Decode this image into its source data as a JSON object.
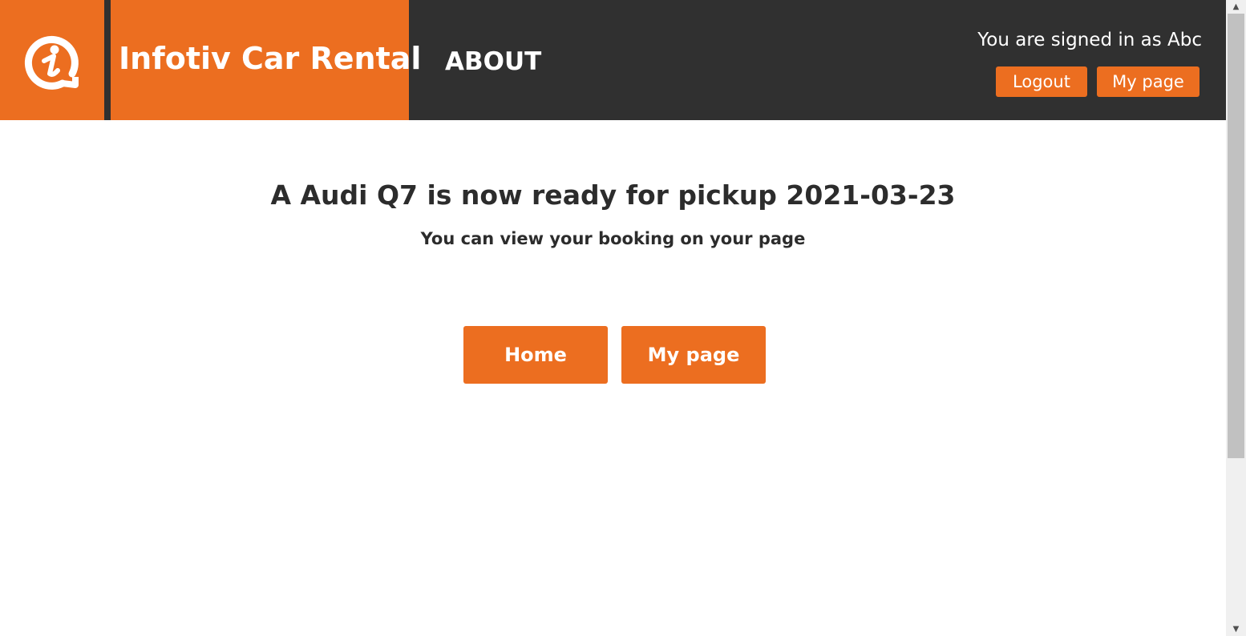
{
  "header": {
    "brand_title": "Infotiv Car Rental",
    "nav_about": "ABOUT",
    "signed_in_text": "You are signed in as Abc",
    "logout_label": "Logout",
    "my_page_label": "My page",
    "logo_icon": "infotiv-logo-icon"
  },
  "main": {
    "confirmation_title": "A Audi Q7 is now ready for pickup 2021-03-23",
    "confirmation_subtitle": "You can view your booking on your page",
    "home_label": "Home",
    "my_page_label": "My page"
  },
  "scrollbar": {
    "up_icon": "scroll-up-arrow-icon",
    "down_icon": "scroll-down-arrow-icon"
  },
  "colors": {
    "brand_orange": "#ec6e20",
    "header_dark": "#303030",
    "text_dark": "#2c2c2c"
  }
}
